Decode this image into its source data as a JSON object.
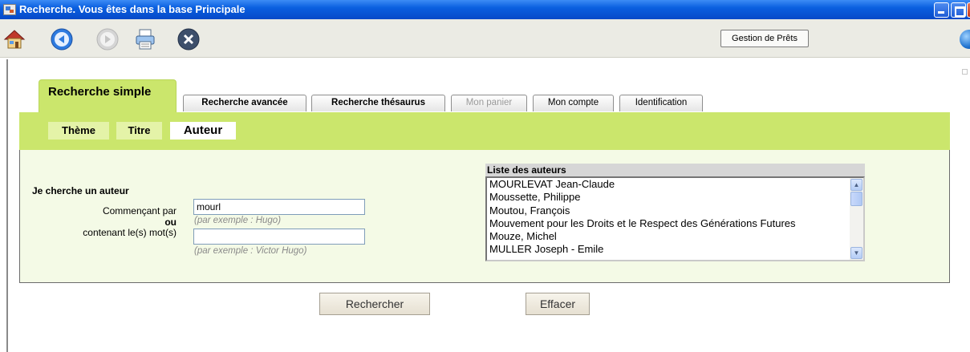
{
  "window": {
    "title": "Recherche. Vous êtes dans la base Principale"
  },
  "toolbar": {
    "icons": [
      "home-icon",
      "back-icon",
      "forward-icon",
      "print-icon",
      "close-icon",
      "globe-icon"
    ],
    "loans_button": "Gestion de Prêts"
  },
  "tabs": [
    {
      "label": "Recherche simple",
      "state": "active"
    },
    {
      "label": "Recherche avancée",
      "state": "normal"
    },
    {
      "label": "Recherche thésaurus",
      "state": "normal"
    },
    {
      "label": "Mon panier",
      "state": "disabled"
    },
    {
      "label": "Mon compte",
      "state": "normal"
    },
    {
      "label": "Identification",
      "state": "normal"
    }
  ],
  "subtabs": [
    {
      "label": "Thème",
      "state": "normal"
    },
    {
      "label": "Titre",
      "state": "normal"
    },
    {
      "label": "Auteur",
      "state": "active"
    }
  ],
  "form": {
    "heading": "Je cherche un auteur",
    "starting_label": "Commençant par",
    "starting_value": "mourl",
    "starting_hint": "(par exemple : Hugo)",
    "or_label": "ou",
    "containing_label": "contenant le(s) mot(s)",
    "containing_value": "",
    "containing_hint": "(par exemple : Victor Hugo)"
  },
  "author_list": {
    "title": "Liste des auteurs",
    "items": [
      "MOURLEVAT Jean-Claude",
      "Moussette, Philippe",
      "Moutou, François",
      "Mouvement pour les Droits et le Respect des Générations Futures",
      "Mouze, Michel",
      "MULLER Joseph - Emile"
    ]
  },
  "buttons": {
    "search": "Rechercher",
    "clear": "Effacer"
  },
  "colors": {
    "titlebar": "#0a5fe0",
    "tab_green": "#cbe66c",
    "panel_bg": "#f4fae6"
  }
}
